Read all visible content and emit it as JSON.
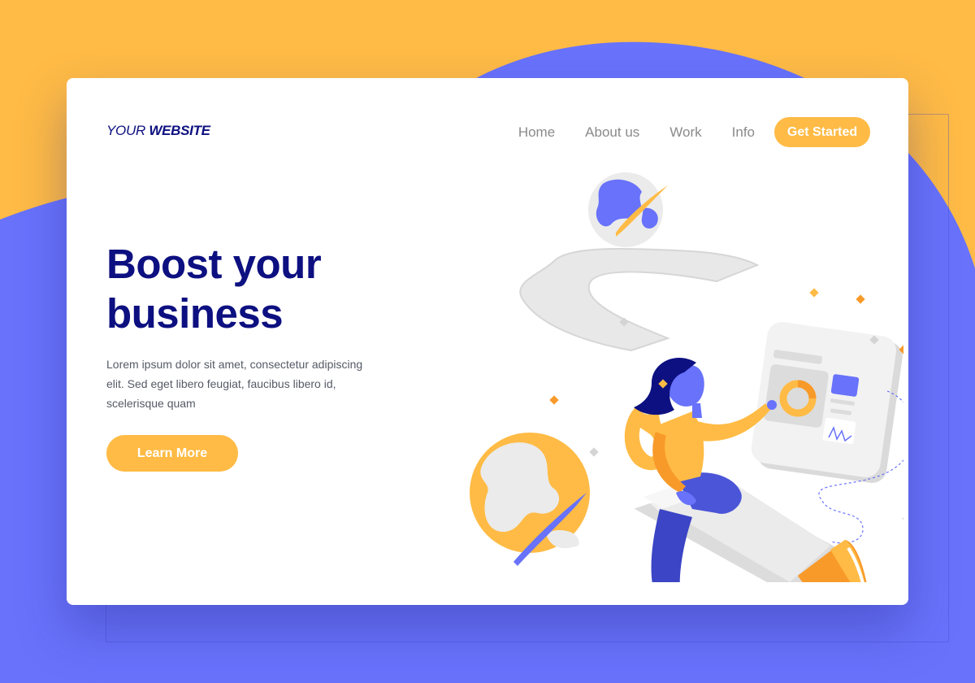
{
  "logo": {
    "part1": "YOUR ",
    "part2": "WEBSITE"
  },
  "nav": {
    "home": "Home",
    "about": "About us",
    "work": "Work",
    "info": "Info",
    "cta": "Get Started"
  },
  "hero": {
    "title_line1": "Boost your",
    "title_line2": "business",
    "description": "Lorem ipsum dolor sit amet, consectetur adipiscing elit. Sed eget libero feugiat, faucibus libero id, scelerisque quam",
    "button": "Learn More"
  },
  "colors": {
    "background_orange": "#ffbb45",
    "background_blue": "#6872fb",
    "text_navy": "#0d1080",
    "accent_yellow": "#ffbb45",
    "nav_gray": "#8a8a8a"
  },
  "illustration": {
    "subject": "woman riding a pencil rocket among planets",
    "icons": [
      "planet-icon",
      "rocket-pencil-icon",
      "dashboard-screen-icon",
      "sparkle-icon"
    ]
  }
}
